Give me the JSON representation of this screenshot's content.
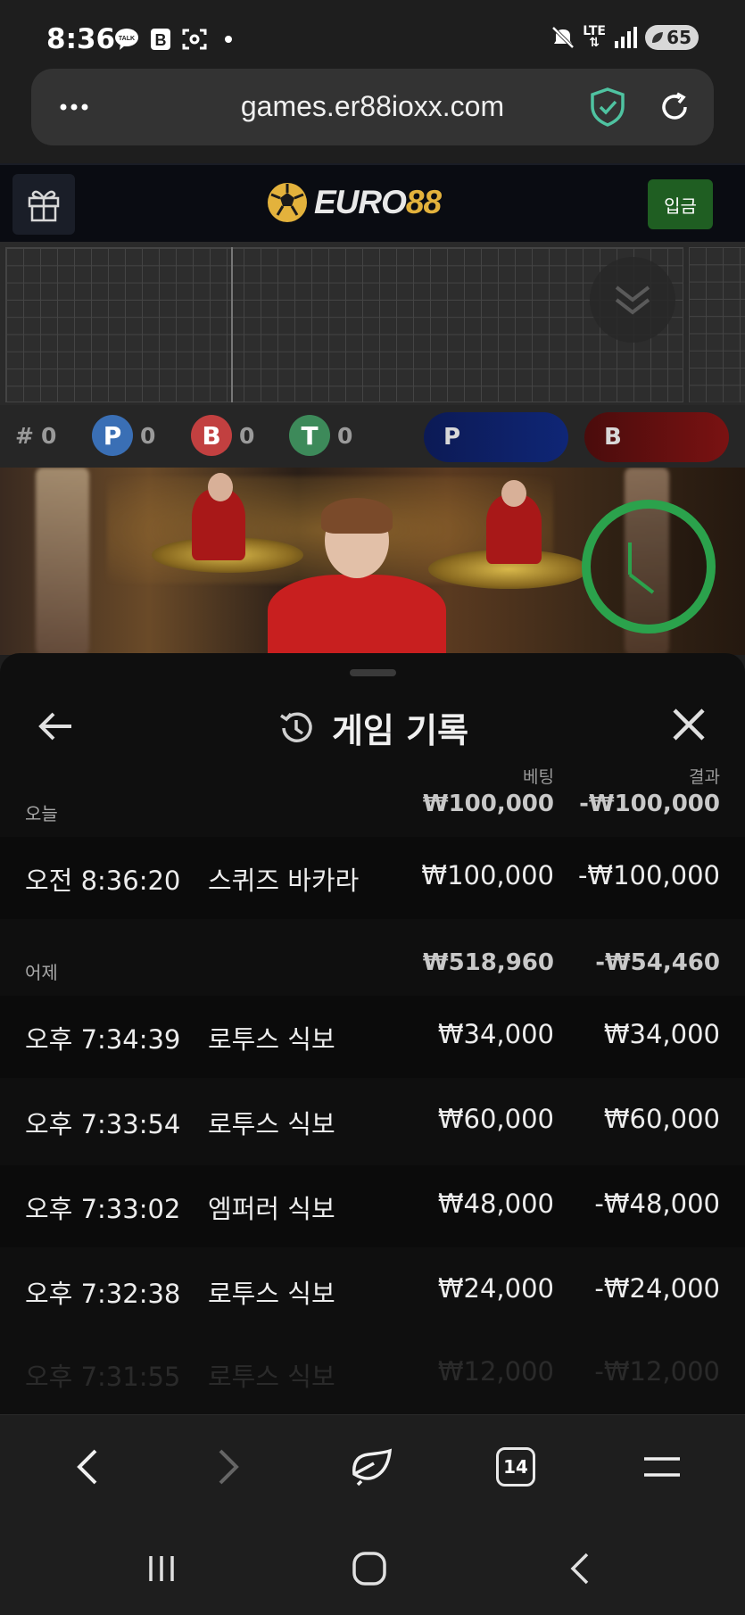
{
  "status_bar": {
    "time": "8:36",
    "network": "LTE",
    "battery": "65"
  },
  "url_bar": {
    "url": "games.er88ioxx.com"
  },
  "app_header": {
    "logo_text_euro": "EURO",
    "logo_text_88": "88",
    "deposit_label": "입금"
  },
  "stats": {
    "hash_label": "#",
    "hash_count": "0",
    "player_label": "P",
    "player_count": "0",
    "banker_label": "B",
    "banker_count": "0",
    "tie_label": "T",
    "tie_count": "0",
    "player_pill_label": "P",
    "banker_pill_label": "B"
  },
  "history": {
    "title": "게임 기록",
    "column_bet": "베팅",
    "column_result": "결과",
    "groups": [
      {
        "label": "오늘",
        "total_bet": "₩100,000",
        "total_result": "-₩100,000",
        "records": [
          {
            "time": "오전 8:36:20",
            "game": "스퀴즈 바카라",
            "bet": "₩100,000",
            "result": "-₩100,000"
          }
        ]
      },
      {
        "label": "어제",
        "total_bet": "₩518,960",
        "total_result": "-₩54,460",
        "records": [
          {
            "time": "오후 7:34:39",
            "game": "로투스 식보",
            "bet": "₩34,000",
            "result": "₩34,000"
          },
          {
            "time": "오후 7:33:54",
            "game": "로투스 식보",
            "bet": "₩60,000",
            "result": "₩60,000"
          },
          {
            "time": "오후 7:33:02",
            "game": "엠퍼러 식보",
            "bet": "₩48,000",
            "result": "-₩48,000"
          },
          {
            "time": "오후 7:32:38",
            "game": "로투스 식보",
            "bet": "₩24,000",
            "result": "-₩24,000"
          },
          {
            "time": "오후 7:31:55",
            "game": "로투스 식보",
            "bet": "₩12,000",
            "result": "-₩12,000"
          }
        ]
      }
    ]
  },
  "browser_nav": {
    "tab_count": "14"
  },
  "colors": {
    "player_blue": "#3a6fb5",
    "banker_red": "#c24040",
    "tie_green": "#3d8a5a",
    "deposit_green": "#1f5e22",
    "logo_gold": "#e3b23c",
    "timer_green": "#2ba24c"
  }
}
